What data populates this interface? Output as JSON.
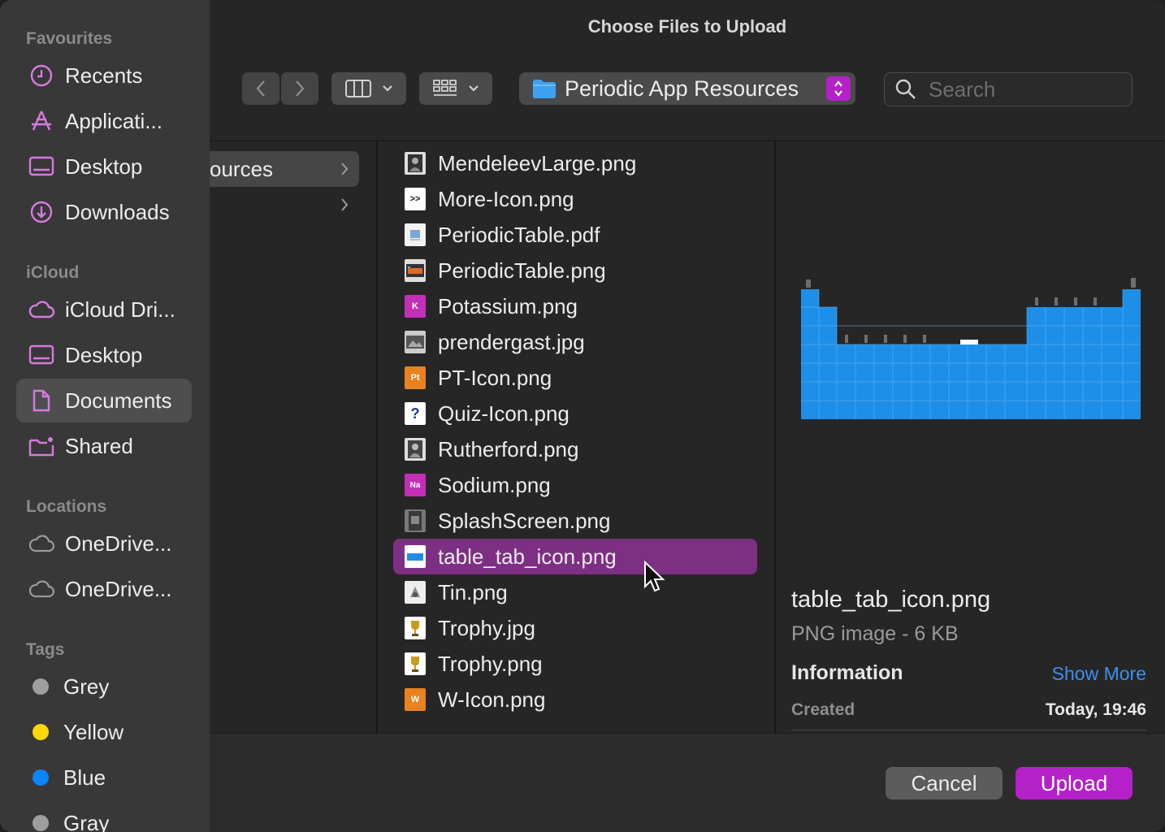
{
  "window": {
    "title": "Choose Files to Upload"
  },
  "sidebar": {
    "sections": {
      "favourites": "Favourites",
      "icloud": "iCloud",
      "locations": "Locations",
      "tags": "Tags"
    },
    "favourites": [
      {
        "label": "Recents",
        "icon": "clock-icon"
      },
      {
        "label": "Applicati...",
        "icon": "applications-icon"
      },
      {
        "label": "Desktop",
        "icon": "desktop-icon"
      },
      {
        "label": "Downloads",
        "icon": "download-icon"
      }
    ],
    "icloud": [
      {
        "label": "iCloud Dri...",
        "icon": "cloud-icon"
      },
      {
        "label": "Desktop",
        "icon": "desktop-icon"
      },
      {
        "label": "Documents",
        "icon": "document-icon",
        "selected": true
      },
      {
        "label": "Shared",
        "icon": "shared-folder-icon"
      }
    ],
    "locations": [
      {
        "label": "OneDrive...",
        "icon": "cloud-icon"
      },
      {
        "label": "OneDrive...",
        "icon": "cloud-icon"
      }
    ],
    "tags": [
      {
        "label": "Grey",
        "color": "#9e9e9e"
      },
      {
        "label": "Yellow",
        "color": "#ffd60a"
      },
      {
        "label": "Blue",
        "color": "#0a84ff"
      },
      {
        "label": "Gray",
        "color": "#9e9e9e"
      }
    ]
  },
  "toolbar": {
    "path_label": "Periodic App Resources",
    "search_placeholder": "Search"
  },
  "columns": {
    "parent": [
      {
        "label": "ources",
        "selected": true
      },
      {
        "label": "",
        "selected": false
      }
    ],
    "files": [
      {
        "name": "MendeleevLarge.png",
        "icon": "portrait-thumb-icon"
      },
      {
        "name": "More-Icon.png",
        "icon": "more-thumb-icon",
        "glyph": ">>"
      },
      {
        "name": "PeriodicTable.pdf",
        "icon": "pdf-thumb-icon"
      },
      {
        "name": "PeriodicTable.png",
        "icon": "table-thumb-icon"
      },
      {
        "name": "Potassium.png",
        "icon": "element-thumb-icon",
        "glyph": "K"
      },
      {
        "name": "prendergast.jpg",
        "icon": "photo-thumb-icon"
      },
      {
        "name": "PT-Icon.png",
        "icon": "element-thumb-icon",
        "glyph": "Pt"
      },
      {
        "name": "Quiz-Icon.png",
        "icon": "quiz-thumb-icon",
        "glyph": "?"
      },
      {
        "name": "Rutherford.png",
        "icon": "portrait-thumb-icon"
      },
      {
        "name": "Sodium.png",
        "icon": "element-thumb-icon",
        "glyph": "Na"
      },
      {
        "name": "SplashScreen.png",
        "icon": "splash-thumb-icon"
      },
      {
        "name": "table_tab_icon.png",
        "icon": "table-tab-thumb-icon",
        "selected": true
      },
      {
        "name": "Tin.png",
        "icon": "tin-thumb-icon"
      },
      {
        "name": "Trophy.jpg",
        "icon": "trophy-thumb-icon"
      },
      {
        "name": "Trophy.png",
        "icon": "trophy-thumb-icon"
      },
      {
        "name": "W-Icon.png",
        "icon": "element-thumb-icon",
        "glyph": "W"
      }
    ]
  },
  "preview": {
    "name": "table_tab_icon.png",
    "kind": "PNG image - 6 KB",
    "info_heading": "Information",
    "show_more": "Show More",
    "created_label": "Created",
    "created_value": "Today, 19:46"
  },
  "buttons": {
    "cancel": "Cancel",
    "upload": "Upload"
  },
  "colors": {
    "accent": "#b521c9",
    "selection": "#7d2f83",
    "link": "#3d8ef0",
    "preview_table": "#1e8fe8"
  }
}
